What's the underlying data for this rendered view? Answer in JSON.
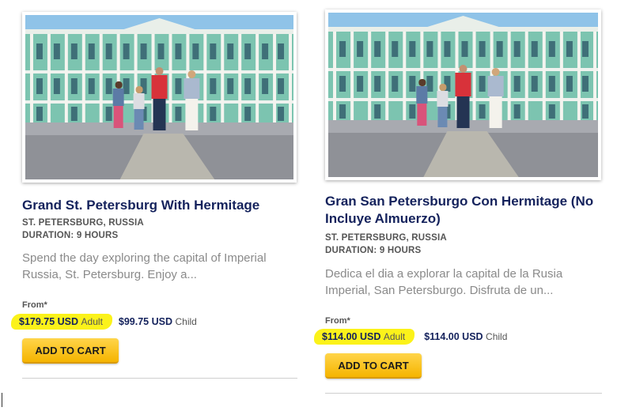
{
  "tours": [
    {
      "title": "Grand St. Petersburg With Hermitage",
      "location": "ST. PETERSBURG, RUSSIA",
      "duration": "DURATION: 9 HOURS",
      "description": "Spend the day exploring the capital of Imperial Russia, St. Petersburg. Enjoy a...",
      "from_label": "From*",
      "adult_price": "$179.75 USD",
      "adult_label": "Adult",
      "child_price": "$99.75 USD",
      "child_label": "Child",
      "add_to_cart": "ADD TO CART"
    },
    {
      "title": "Gran San Petersburgo Con Hermitage (No Incluye Almuerzo)",
      "location": "ST. PETERSBURG, RUSSIA",
      "duration": "DURATION: 9 HOURS",
      "description": "Dedica el dia a explorar la capital de la Rusia Imperial, San Petersburgo. Disfruta de un...",
      "from_label": "From*",
      "adult_price": "$114.00 USD",
      "adult_label": "Adult",
      "child_price": "$114.00 USD",
      "child_label": "Child",
      "add_to_cart": "ADD TO CART"
    }
  ],
  "colors": {
    "title": "#14225c",
    "highlight": "#fbf21a",
    "button": "#f5b400",
    "palace_facade": "#7cc4b0",
    "sky": "#8fc3e8"
  },
  "icons": [
    "hermitage-photo"
  ]
}
